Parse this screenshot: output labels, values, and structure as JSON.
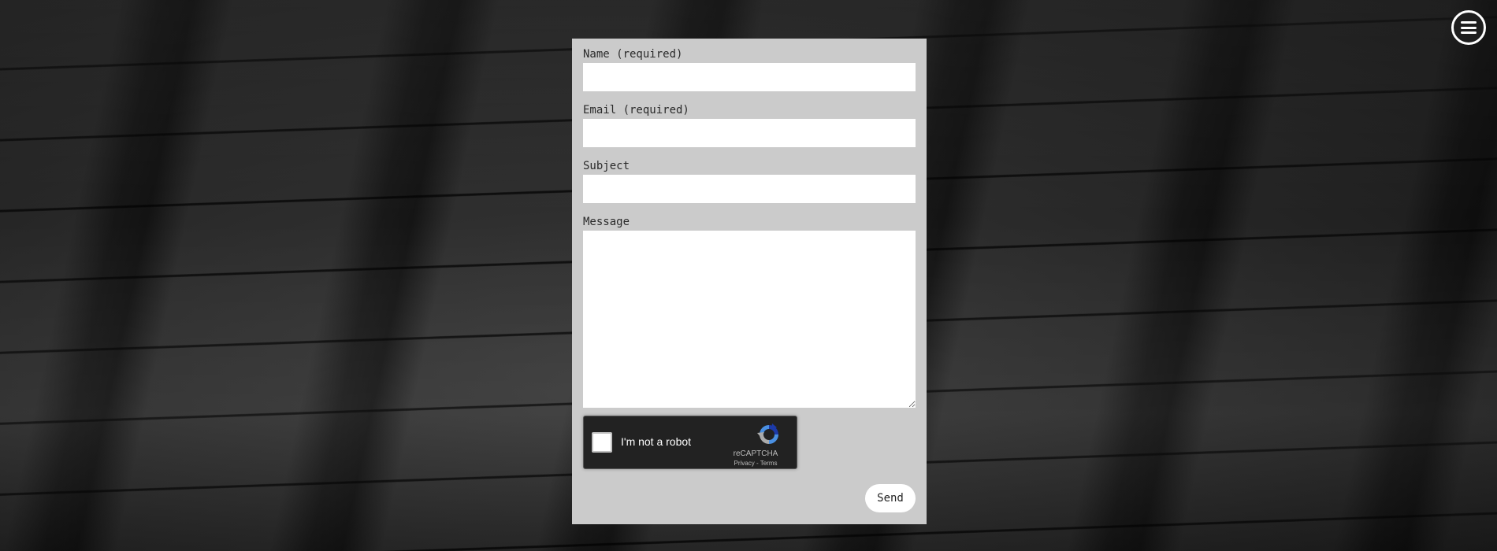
{
  "form": {
    "name_label": "Name (required)",
    "name_value": "",
    "email_label": "Email (required)",
    "email_value": "",
    "subject_label": "Subject",
    "subject_value": "",
    "message_label": "Message",
    "message_value": "",
    "send_label": "Send"
  },
  "recaptcha": {
    "checkbox_label": "I'm not a robot",
    "brand": "reCAPTCHA",
    "privacy_link": "Privacy",
    "separator": " - ",
    "terms_link": "Terms",
    "checked": false
  },
  "menu": {
    "icon": "hamburger-menu-icon"
  },
  "colors": {
    "card_background": "#cbcbcb",
    "input_background": "#ffffff",
    "recaptcha_background": "#222222",
    "recaptcha_logo_blue": "#1c3aa9",
    "recaptcha_logo_light": "#4a90e2",
    "recaptcha_logo_gray": "#ababab"
  }
}
